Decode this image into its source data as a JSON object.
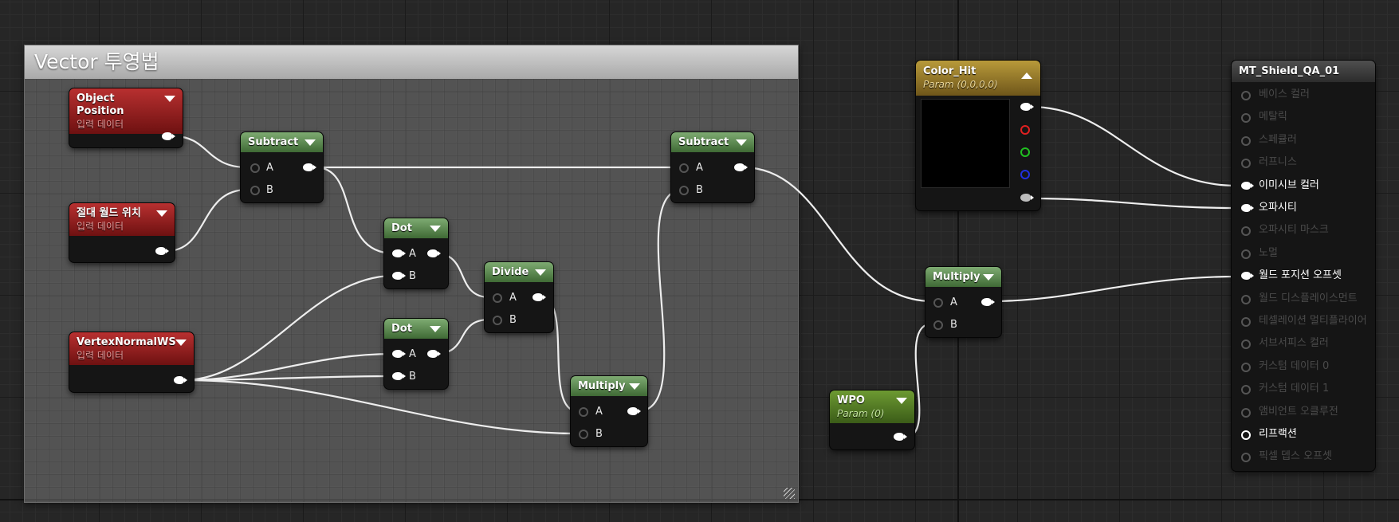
{
  "comment_box": {
    "title": "Vector 투영법"
  },
  "nodes": {
    "object_position": {
      "title": "Object Position",
      "subtitle": "입력 데이터"
    },
    "absolute_world_position": {
      "title": "절대 월드 위치",
      "subtitle": "입력 데이터"
    },
    "vertex_normal_ws": {
      "title": "VertexNormalWS",
      "subtitle": "입력 데이터"
    },
    "subtract_1": {
      "title": "Subtract",
      "pin_a": "A",
      "pin_b": "B"
    },
    "dot_1": {
      "title": "Dot",
      "pin_a": "A",
      "pin_b": "B"
    },
    "dot_2": {
      "title": "Dot",
      "pin_a": "A",
      "pin_b": "B"
    },
    "divide": {
      "title": "Divide",
      "pin_a": "A",
      "pin_b": "B"
    },
    "multiply_1": {
      "title": "Multiply",
      "pin_a": "A",
      "pin_b": "B"
    },
    "subtract_2": {
      "title": "Subtract",
      "pin_a": "A",
      "pin_b": "B"
    },
    "color_hit": {
      "title": "Color_Hit",
      "subtitle": "Param (0,0,0,0)",
      "preview_color": "#000000",
      "pin_colors": [
        "#ffffff",
        "#e02020",
        "#20c020",
        "#2030e0",
        "#bdbdbd"
      ]
    },
    "multiply_2": {
      "title": "Multiply",
      "pin_a": "A",
      "pin_b": "B"
    },
    "wpo": {
      "title": "WPO",
      "subtitle": "Param (0)"
    },
    "material": {
      "title": "MT_Shield_QA_01",
      "inputs": [
        {
          "label": "베이스 컬러",
          "active": false
        },
        {
          "label": "메탈릭",
          "active": false
        },
        {
          "label": "스페큘러",
          "active": false
        },
        {
          "label": "러프니스",
          "active": false
        },
        {
          "label": "이미시브 컬러",
          "active": true
        },
        {
          "label": "오파시티",
          "active": true
        },
        {
          "label": "오파시티 마스크",
          "active": false
        },
        {
          "label": "노멀",
          "active": false
        },
        {
          "label": "월드 포지션 오프셋",
          "active": true
        },
        {
          "label": "월드 디스플레이스먼트",
          "active": false
        },
        {
          "label": "테셀레이션 멀티플라이어",
          "active": false
        },
        {
          "label": "서브서피스 컬러",
          "active": false
        },
        {
          "label": "커스텀 데이터 0",
          "active": false
        },
        {
          "label": "커스텀 데이터 1",
          "active": false
        },
        {
          "label": "앰비언트 오클루전",
          "active": false
        },
        {
          "label": "리프랙션",
          "active": true
        },
        {
          "label": "픽셀 뎁스 오프셋",
          "active": false
        }
      ]
    }
  },
  "colors": {
    "input_header": "#a82424",
    "function_header": "#5f8a52",
    "param_header": "#9a7f2a",
    "vector_param_header": "#5e8a2a",
    "wire": "#eeeeee"
  }
}
